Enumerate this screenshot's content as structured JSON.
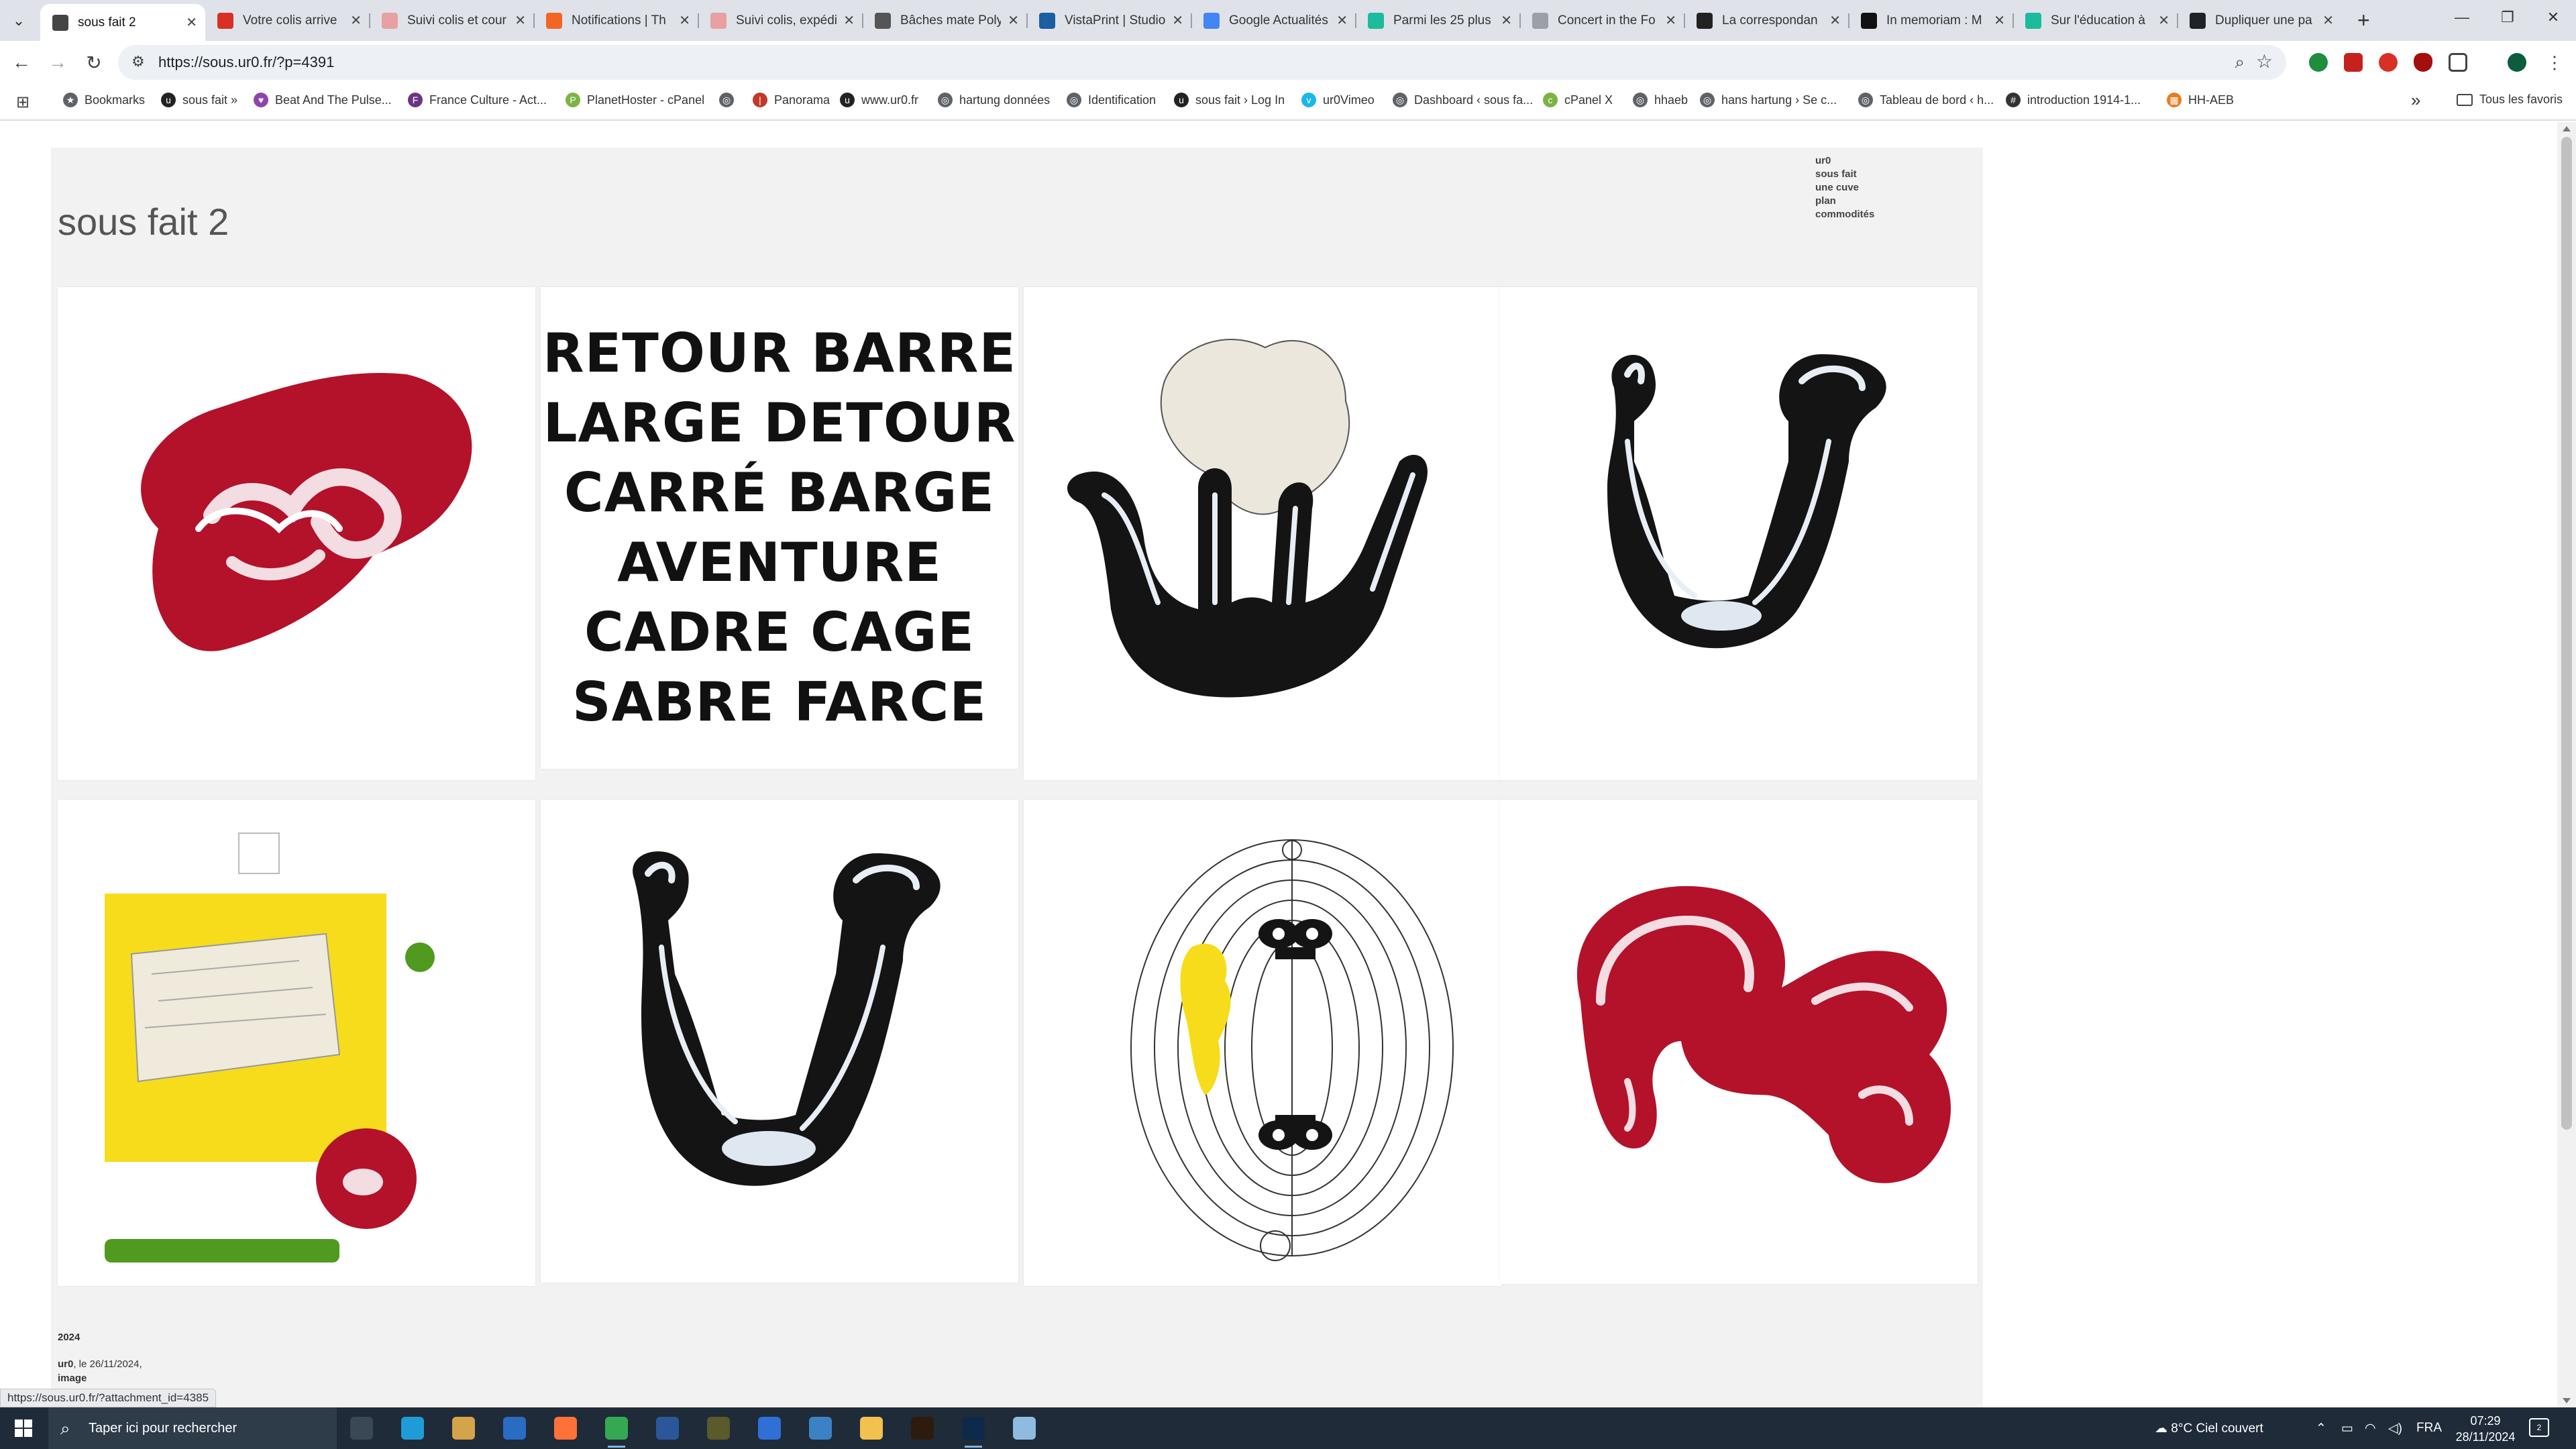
{
  "browser": {
    "tabs": [
      {
        "title": "sous fait 2",
        "active": true,
        "favicon_color": "#444444"
      },
      {
        "title": "Votre colis arrive",
        "favicon_color": "#d93025"
      },
      {
        "title": "Suivi colis et cour",
        "favicon_color": "#e8a0a0"
      },
      {
        "title": "Notifications | Th",
        "favicon_color": "#f26522"
      },
      {
        "title": "Suivi colis, expédi",
        "favicon_color": "#e8a0a0"
      },
      {
        "title": "Bâches mate Poly",
        "favicon_color": "#555555"
      },
      {
        "title": "VistaPrint | Studio",
        "favicon_color": "#1a5fa0"
      },
      {
        "title": "Google Actualités",
        "favicon_color": "#4285f4"
      },
      {
        "title": "Parmi les 25 plus",
        "favicon_color": "#1abc9c"
      },
      {
        "title": "Concert in the Fo",
        "favicon_color": "#9aa0a6"
      },
      {
        "title": "La correspondan",
        "favicon_color": "#222222"
      },
      {
        "title": "In memoriam : M",
        "favicon_color": "#111111"
      },
      {
        "title": "Sur l'éducation à",
        "favicon_color": "#1abc9c"
      },
      {
        "title": "Dupliquer une pa",
        "favicon_color": "#1d2327"
      }
    ],
    "tab_close_glyph": "✕",
    "new_tab_glyph": "+",
    "url": "https://sous.ur0.fr/?p=4391",
    "bookmarks": [
      {
        "label": "Bookmarks",
        "icon_color": "#5f6368",
        "glyph": "★"
      },
      {
        "label": "sous fait »",
        "icon_color": "#222222",
        "glyph": "u"
      },
      {
        "label": "Beat And The Pulse...",
        "icon_color": "#8e44ad",
        "glyph": "♥"
      },
      {
        "label": "France Culture - Act...",
        "icon_color": "#6c3483",
        "glyph": "F"
      },
      {
        "label": "PlanetHoster - cPanel",
        "icon_color": "#7cb342",
        "glyph": "P"
      },
      {
        "label": "",
        "icon_color": "#5f6368",
        "glyph": "◎"
      },
      {
        "label": "Panorama",
        "icon_color": "#c0392b",
        "glyph": "|"
      },
      {
        "label": "www.ur0.fr",
        "icon_color": "#222222",
        "glyph": "u"
      },
      {
        "label": "hartung données",
        "icon_color": "#5f6368",
        "glyph": "◎"
      },
      {
        "label": "Identification",
        "icon_color": "#5f6368",
        "glyph": "◎"
      },
      {
        "label": "sous fait › Log In",
        "icon_color": "#222222",
        "glyph": "u"
      },
      {
        "label": "ur0Vimeo",
        "icon_color": "#1ab7ea",
        "glyph": "v"
      },
      {
        "label": "Dashboard ‹ sous fa...",
        "icon_color": "#5f6368",
        "glyph": "◎"
      },
      {
        "label": "cPanel X",
        "icon_color": "#7cb342",
        "glyph": "c"
      },
      {
        "label": "hhaeb",
        "icon_color": "#5f6368",
        "glyph": "◎"
      },
      {
        "label": "hans hartung › Se c...",
        "icon_color": "#5f6368",
        "glyph": "◎"
      },
      {
        "label": "Tableau de bord ‹ h...",
        "icon_color": "#5f6368",
        "glyph": "◎"
      },
      {
        "label": "introduction 1914-1...",
        "icon_color": "#333333",
        "glyph": "#"
      },
      {
        "label": "HH-AEB",
        "icon_color": "#e67e22",
        "glyph": "▦"
      }
    ],
    "all_bookmarks_label": "Tous les favoris"
  },
  "page": {
    "site_title": "sous fait 2",
    "menu": [
      "ur0",
      "sous fait",
      "une cuve",
      "plan",
      "commodités"
    ],
    "artwork_words": [
      "RETOUR BARRE",
      "LARGE DETOUR",
      "CARRÉ BARGE",
      "AVENTURE",
      "CADRE CAGE",
      "SABRE FARCE"
    ],
    "post_year": "2024",
    "post_author": "ur0",
    "post_date_text": ", le 26/11/2024,",
    "post_category": "image",
    "status_url": "https://sous.ur0.fr/?attachment_id=4385"
  },
  "taskbar": {
    "search_placeholder": "Taper ici pour rechercher",
    "weather": "8°C  Ciel couvert",
    "language": "FRA",
    "time": "07:29",
    "date": "28/11/2024",
    "notification_count": "2",
    "apps": [
      {
        "name": "task-view",
        "color": "#3a4755"
      },
      {
        "name": "edge",
        "color": "#1f9bd8"
      },
      {
        "name": "photos",
        "color": "#d4a34a"
      },
      {
        "name": "outlook",
        "color": "#2a6cc4"
      },
      {
        "name": "firefox",
        "color": "#ff7139"
      },
      {
        "name": "chrome",
        "color": "#34a853",
        "running": true
      },
      {
        "name": "word",
        "color": "#2b579a"
      },
      {
        "name": "daz-studio",
        "color": "#5a5a2a"
      },
      {
        "name": "thunderbird",
        "color": "#2f6fd6"
      },
      {
        "name": "store",
        "color": "#3b82c4"
      },
      {
        "name": "file-explorer",
        "color": "#f2c14e"
      },
      {
        "name": "bridge",
        "color": "#2d1b0e"
      },
      {
        "name": "photoshop",
        "color": "#0d2a4a",
        "running": true
      },
      {
        "name": "notepad",
        "color": "#8fbbe0"
      }
    ]
  },
  "colors": {
    "tabstrip": "#dfe3e9",
    "omnibox": "#edf0f5",
    "page_panel": "#f2f2f2",
    "taskbar": "#1f2b38",
    "red_paint": "#b3122a",
    "black_ink": "#141414",
    "yellow_paint": "#f7dc1c",
    "green_paint": "#4f9a1f"
  }
}
